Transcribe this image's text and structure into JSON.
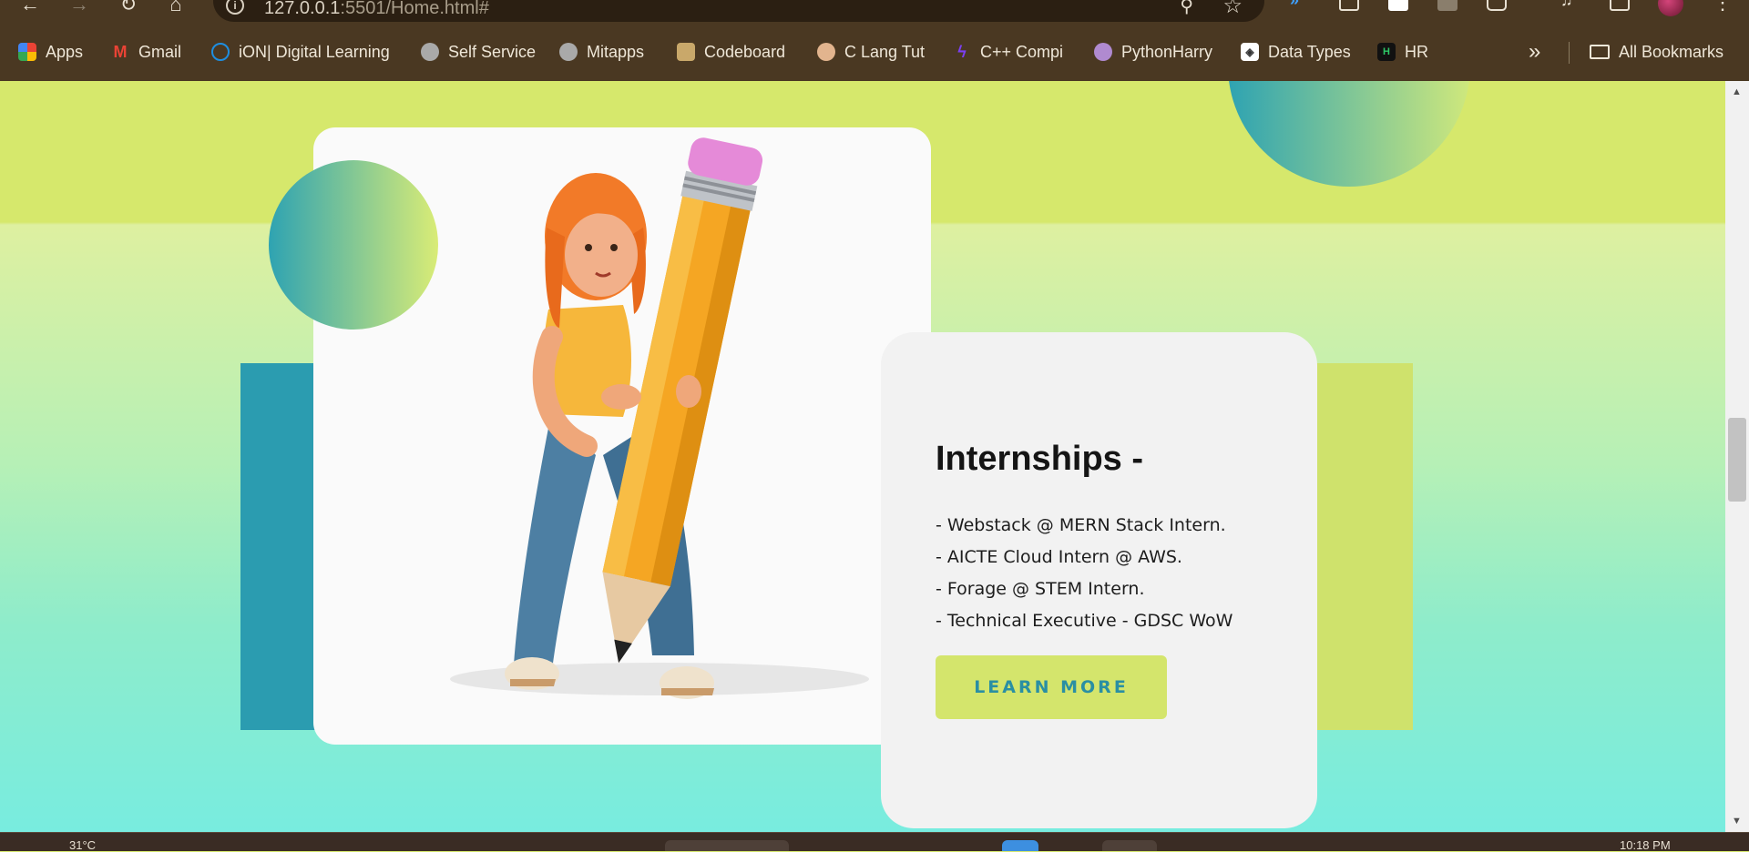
{
  "browser": {
    "url_host": "127.0.0.1",
    "url_rest": ":5501/Home.html#",
    "bookmarks": [
      {
        "label": "Apps"
      },
      {
        "label": "Gmail"
      },
      {
        "label": "iON| Digital Learning"
      },
      {
        "label": "Self Service"
      },
      {
        "label": "Mitapps"
      },
      {
        "label": "Codeboard"
      },
      {
        "label": "C Lang Tut"
      },
      {
        "label": "C++ Compi"
      },
      {
        "label": "PythonHarry"
      },
      {
        "label": "Data Types"
      },
      {
        "label": "HR"
      }
    ],
    "all_bookmarks": "All Bookmarks",
    "more_glyph": "»"
  },
  "icons": {
    "back": "arrow-left-icon",
    "forward": "arrow-right-icon",
    "reload": "reload-icon",
    "home": "home-icon",
    "info": "site-info-icon",
    "zoom": "search-icon",
    "bookmark_star": "star-icon",
    "folder": "folder-icon"
  },
  "colors": {
    "chrome": "#4a3822",
    "lime": "#d6e86c",
    "teal": "#2b9cb0",
    "aqua": "#78ecdf",
    "button_text": "#2a8fa3"
  },
  "section": {
    "title": "Internships -",
    "items": [
      "- Webstack @ MERN Stack Intern.",
      "- AICTE Cloud Intern @ AWS.",
      "- Forage @ STEM Intern.",
      "- Technical Executive - GDSC WoW"
    ],
    "button": "LEARN MORE"
  },
  "taskbar": {
    "weather": "31°C",
    "time": "10:18 PM"
  }
}
